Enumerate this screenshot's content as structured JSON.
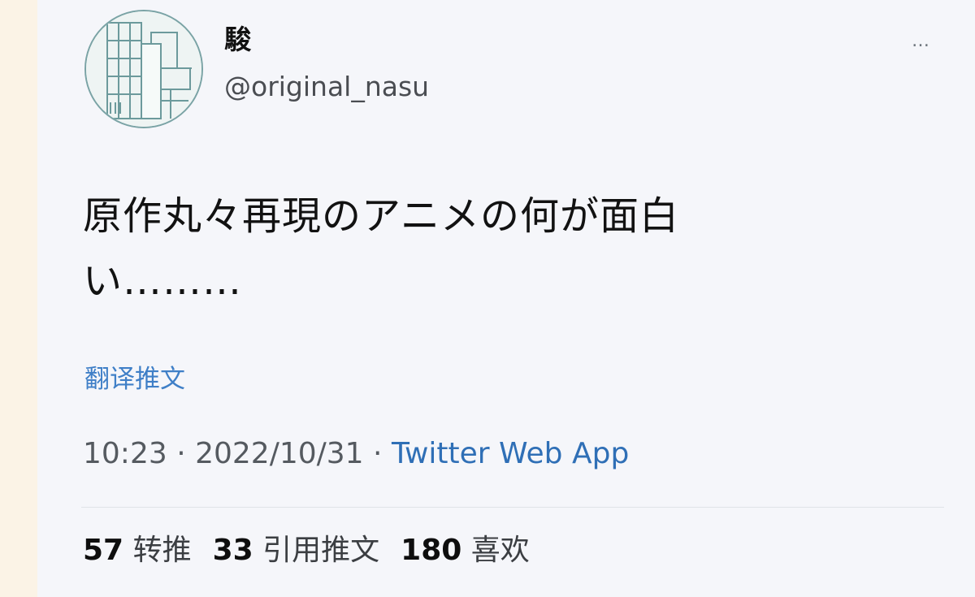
{
  "user": {
    "display_name": "駿",
    "handle": "@original_nasu"
  },
  "menu": {
    "more_icon": "…"
  },
  "tweet": {
    "line1": "原作丸々再現のアニメの何が面白",
    "line2": "い………",
    "translate_label": "翻译推文"
  },
  "meta": {
    "time": "10:23",
    "sep1": " · ",
    "date": "2022/10/31",
    "sep2": " · ",
    "app": "Twitter Web App"
  },
  "stats": {
    "retweets": {
      "count": "57",
      "label": "转推"
    },
    "quotes": {
      "count": "33",
      "label": "引用推文"
    },
    "likes": {
      "count": "180",
      "label": "喜欢"
    }
  },
  "colors": {
    "link": "#3f7fc7",
    "text": "#121212",
    "muted": "#555a60"
  }
}
